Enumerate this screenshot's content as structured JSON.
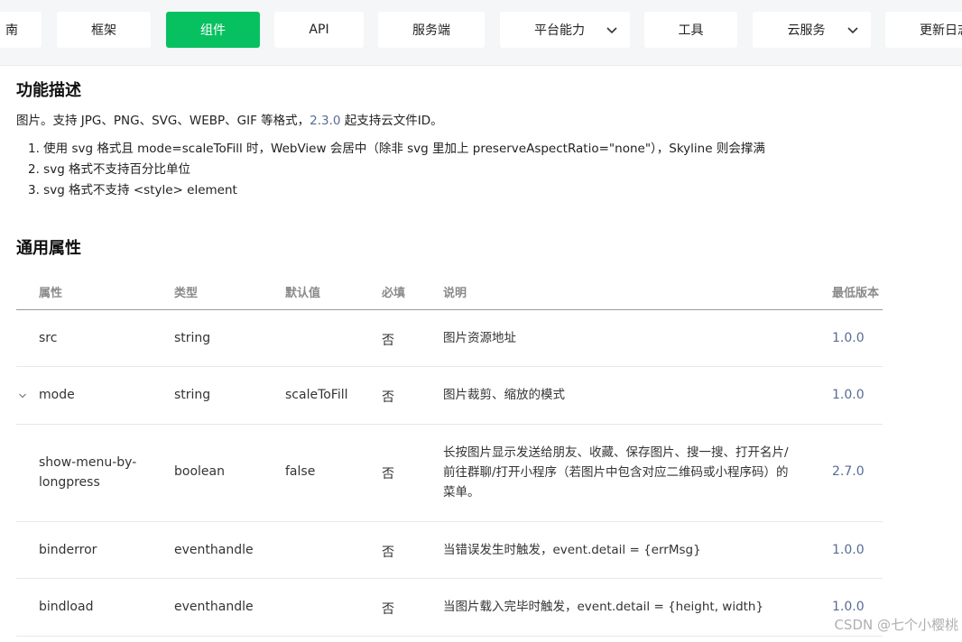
{
  "nav": {
    "tabs": [
      {
        "label": "南"
      },
      {
        "label": "框架"
      },
      {
        "label": "组件"
      },
      {
        "label": "API"
      },
      {
        "label": "服务端"
      },
      {
        "label": "平台能力"
      },
      {
        "label": "工具"
      },
      {
        "label": "云服务"
      },
      {
        "label": "更新日志"
      }
    ],
    "active_tab": "组件"
  },
  "section1": {
    "title": "功能描述",
    "intro_before": "图片。支持 JPG、PNG、SVG、WEBP、GIF 等格式，",
    "intro_link": "2.3.0",
    "intro_after": " 起支持云文件ID。",
    "notes": [
      "1. 使用 svg 格式且 mode=scaleToFill 时，WebView 会居中（除非 svg 里加上 preserveAspectRatio=\"none\"），Skyline 则会撑满",
      "2. svg 格式不支持百分比单位",
      "3. svg 格式不支持 <style> element"
    ]
  },
  "section2": {
    "title": "通用属性",
    "headers": {
      "attr": "属性",
      "type": "类型",
      "default": "默认值",
      "required": "必填",
      "desc": "说明",
      "min_version": "最低版本"
    },
    "rows": [
      {
        "attr": "src",
        "type": "string",
        "default": "",
        "required": "否",
        "desc": "图片资源地址",
        "version": "1.0.0"
      },
      {
        "attr": "mode",
        "type": "string",
        "default": "scaleToFill",
        "required": "否",
        "desc": "图片裁剪、缩放的模式",
        "version": "1.0.0"
      },
      {
        "attr": "show-menu-by-longpress",
        "type": "boolean",
        "default": "false",
        "required": "否",
        "desc": "长按图片显示发送给朋友、收藏、保存图片、搜一搜、打开名片/前往群聊/打开小程序（若图片中包含对应二维码或小程序码）的菜单。",
        "version": "2.7.0"
      },
      {
        "attr": "binderror",
        "type": "eventhandle",
        "default": "",
        "required": "否",
        "desc": "当错误发生时触发，event.detail = {errMsg}",
        "version": "1.0.0"
      },
      {
        "attr": "bindload",
        "type": "eventhandle",
        "default": "",
        "required": "否",
        "desc": "当图片载入完毕时触发，event.detail = {height, width}",
        "version": "1.0.0"
      }
    ]
  },
  "watermark": "CSDN @七个小樱桃",
  "colors": {
    "accent": "#07c160",
    "link": "#576b95",
    "nav_bg": "#f5f6f7"
  }
}
